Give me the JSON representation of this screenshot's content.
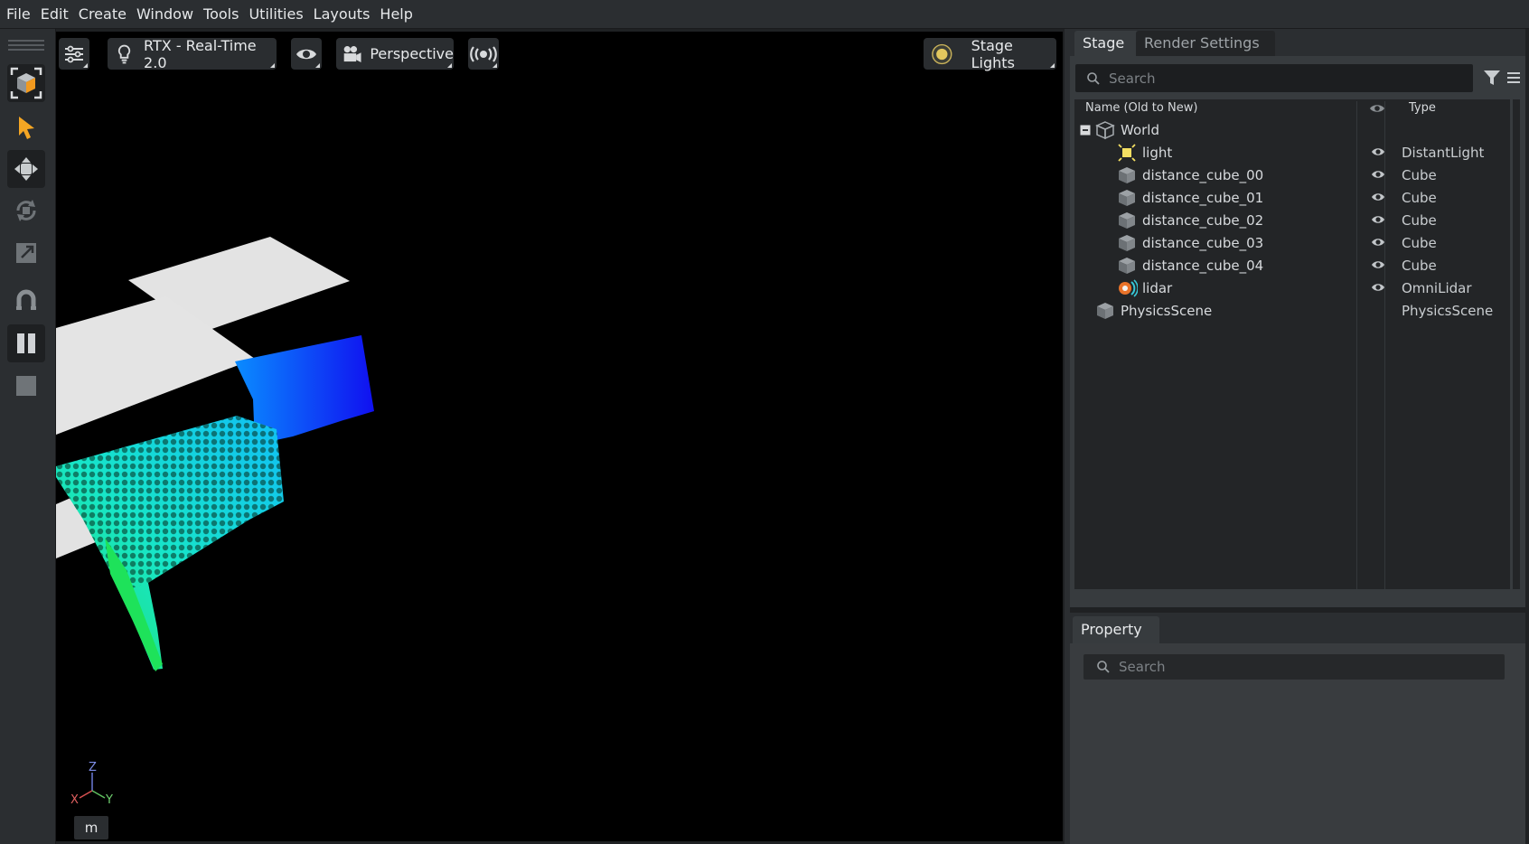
{
  "menu": [
    "File",
    "Edit",
    "Create",
    "Window",
    "Tools",
    "Utilities",
    "Layouts",
    "Help"
  ],
  "viewport": {
    "renderer_label": "RTX - Real-Time 2.0",
    "camera_label": "Perspective",
    "lights_label": "Stage Lights",
    "axis": {
      "z": "Z",
      "x": "X",
      "y": "Y"
    },
    "unit": "m"
  },
  "toolbar": {
    "tools": [
      "snap-cube-icon",
      "select-arrow-icon",
      "move-icon",
      "rotate-icon",
      "scale-icon",
      "magnet-icon",
      "pause-icon",
      "stop-icon"
    ]
  },
  "stage": {
    "tabs": [
      "Stage",
      "Render Settings"
    ],
    "search_placeholder": "Search",
    "columns": {
      "name": "Name (Old to New)",
      "type": "Type"
    },
    "rows": [
      {
        "name": "World",
        "type": "",
        "icon": "xform-icon"
      },
      {
        "name": "light",
        "type": "DistantLight",
        "icon": "light-icon"
      },
      {
        "name": "distance_cube_00",
        "type": "Cube",
        "icon": "cube-icon"
      },
      {
        "name": "distance_cube_01",
        "type": "Cube",
        "icon": "cube-icon"
      },
      {
        "name": "distance_cube_02",
        "type": "Cube",
        "icon": "cube-icon"
      },
      {
        "name": "distance_cube_03",
        "type": "Cube",
        "icon": "cube-icon"
      },
      {
        "name": "distance_cube_04",
        "type": "Cube",
        "icon": "cube-icon"
      },
      {
        "name": "lidar",
        "type": "OmniLidar",
        "icon": "lidar-icon"
      },
      {
        "name": "PhysicsScene",
        "type": "PhysicsScene",
        "icon": "physics-scene-icon"
      }
    ]
  },
  "property": {
    "tab": "Property",
    "search_placeholder": "Search"
  },
  "colors": {
    "accent": "#f5a623",
    "background": "#000000",
    "panel": "#2b2e31"
  }
}
